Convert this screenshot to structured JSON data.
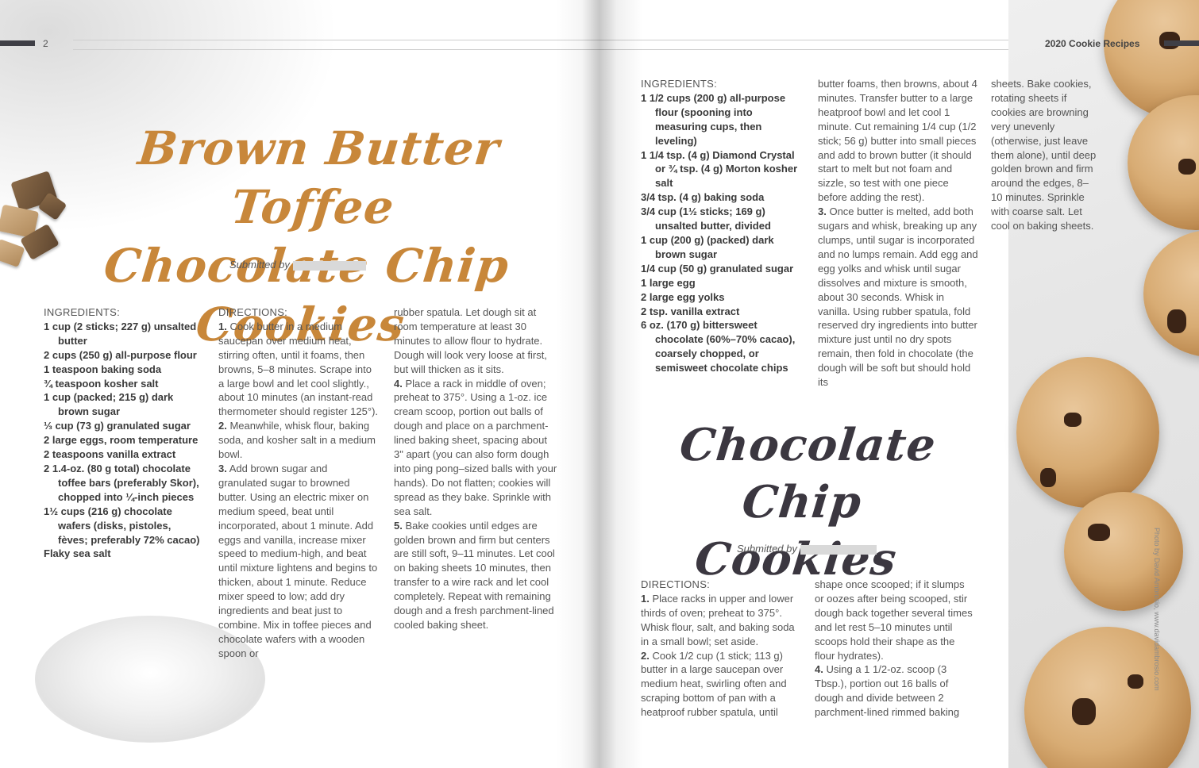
{
  "header": {
    "page_number": "2",
    "running_title": "2020 Cookie Recipes"
  },
  "recipe1": {
    "title_line1": "Brown Butter Toffee",
    "title_line2": "Chocolate Chip Cookies",
    "submitted_label": "Submitted by",
    "ingredients_heading": "INGREDIENTS:",
    "ingredients": [
      "1 cup (2 sticks; 227 g) unsalted butter",
      "2 cups (250 g) all-purpose flour",
      "1 teaspoon baking soda",
      "¾ teaspoon kosher salt",
      "1 cup (packed; 215 g) dark brown sugar",
      "⅓ cup (73 g) granulated sugar",
      "2 large eggs, room temperature",
      "2 teaspoons vanilla extract",
      "2 1.4-oz. (80 g total) chocolate toffee bars (preferably Skor), chopped into ¼-inch pieces",
      "1½ cups (216 g) chocolate wafers (disks, pistoles, fèves; preferably 72% cacao)",
      "Flaky sea salt"
    ],
    "directions_heading": "DIRECTIONS:",
    "directions_col1": [
      {
        "num": "1.",
        "text": "Cook butter in a medium saucepan over medium heat, stirring often, until it foams, then browns, 5–8 minutes. Scrape into a large bowl and let cool slightly., about 10 minutes (an instant-read thermometer should register 125°)."
      },
      {
        "num": "2.",
        "text": "Meanwhile, whisk flour, baking soda, and kosher salt in a medium bowl."
      },
      {
        "num": "3.",
        "text": "Add brown sugar and granulated sugar to browned butter. Using an electric mixer on medium speed, beat until incorporated, about 1 minute. Add eggs and vanilla, increase mixer speed to medium-high, and beat until mixture lightens and begins to thicken, about 1 minute. Reduce mixer speed to low; add dry ingredients and beat just to combine. Mix in toffee pieces and chocolate wafers with a wooden spoon or"
      }
    ],
    "directions_col2_lead": "rubber spatula. Let dough sit at room temperature at least 30 minutes to allow flour to hydrate. Dough will look very loose at first, but will thicken as it sits.",
    "directions_col2": [
      {
        "num": "4.",
        "text": "Place a rack in middle of oven; preheat to 375°. Using a 1-oz. ice cream scoop, portion out balls of dough and place on a parchment-lined baking sheet, spacing about 3\" apart (you can also form dough into ping pong–sized balls with your hands). Do not flatten; cookies will spread as they bake. Sprinkle with sea salt."
      },
      {
        "num": "5.",
        "text": "Bake cookies until edges are golden brown and firm but centers are still soft, 9–11 minutes. Let cool on baking sheets 10 minutes, then transfer to a wire rack and let cool completely. Repeat with remaining dough and a fresh parchment-lined cooled baking sheet."
      }
    ]
  },
  "recipe2": {
    "title_line1": "Chocolate Chip",
    "title_line2": "Cookies",
    "submitted_label": "Submitted by",
    "ingredients_heading": "INGREDIENTS:",
    "ingredients": [
      "1 1/2 cups (200 g) all-purpose flour (spooning into measuring cups, then leveling)",
      "1 1/4 tsp. (4 g) Diamond Crystal or ¾ tsp. (4 g) Morton kosher salt",
      "3/4 tsp. (4 g) baking soda",
      "3/4 cup (1½ sticks; 169 g) unsalted butter, divided",
      "1 cup (200 g) (packed) dark brown sugar",
      "1/4 cup (50 g) granulated sugar",
      "1 large egg",
      "2 large egg yolks",
      "2 tsp. vanilla extract",
      "6 oz. (170 g) bittersweet chocolate (60%–70% cacao), coarsely chopped, or semisweet chocolate chips"
    ],
    "top_col2_lead": "butter foams, then browns, about 4 minutes. Transfer butter to a large heatproof bowl and let cool 1 minute. Cut remaining 1/4 cup (1/2 stick; 56 g) butter into small pieces and add to brown butter (it should start to melt but not foam and sizzle, so test with one piece before adding the rest).",
    "top_col2": [
      {
        "num": "3.",
        "text": "Once butter is melted, add both sugars and whisk, breaking up any clumps, until sugar is incorporated and no lumps remain. Add egg and egg yolks and whisk until sugar dissolves and mixture is smooth, about 30 seconds. Whisk in vanilla. Using rubber spatula, fold reserved dry ingredients into butter mixture just until no dry spots remain, then fold in chocolate (the dough will be soft but should hold its"
      }
    ],
    "top_col3": "sheets. Bake cookies, rotating sheets if cookies are browning very unevenly (otherwise, just leave them alone), until deep golden brown and firm around the edges, 8–10 minutes. Sprinkle with coarse salt. Let cool on baking sheets.",
    "directions_heading": "DIRECTIONS:",
    "directions_col1": [
      {
        "num": "1.",
        "text": "Place racks in upper and lower thirds of oven; preheat to 375°. Whisk flour, salt, and baking soda in a small bowl; set aside."
      },
      {
        "num": "2.",
        "text": "Cook 1/2 cup (1 stick; 113 g) butter in a large saucepan over medium heat, swirling often and scraping bottom of pan with a heatproof rubber spatula, until"
      }
    ],
    "directions_col2_lead": "shape once scooped; if it slumps or oozes after being scooped, stir dough back together several times and let rest 5–10 minutes until scoops hold their shape as the flour hydrates).",
    "directions_col2": [
      {
        "num": "4.",
        "text": "Using a 1 1/2-oz. scoop (3 Tbsp.), portion out 16 balls of dough and divide between 2 parchment-lined rimmed baking"
      }
    ]
  },
  "photo_credit": "Photo by David Ambrosio, www.davidambrosio.com",
  "colors": {
    "title1": "#c8873a",
    "title2": "#3b3740",
    "header_bar": "#3f3f46"
  }
}
